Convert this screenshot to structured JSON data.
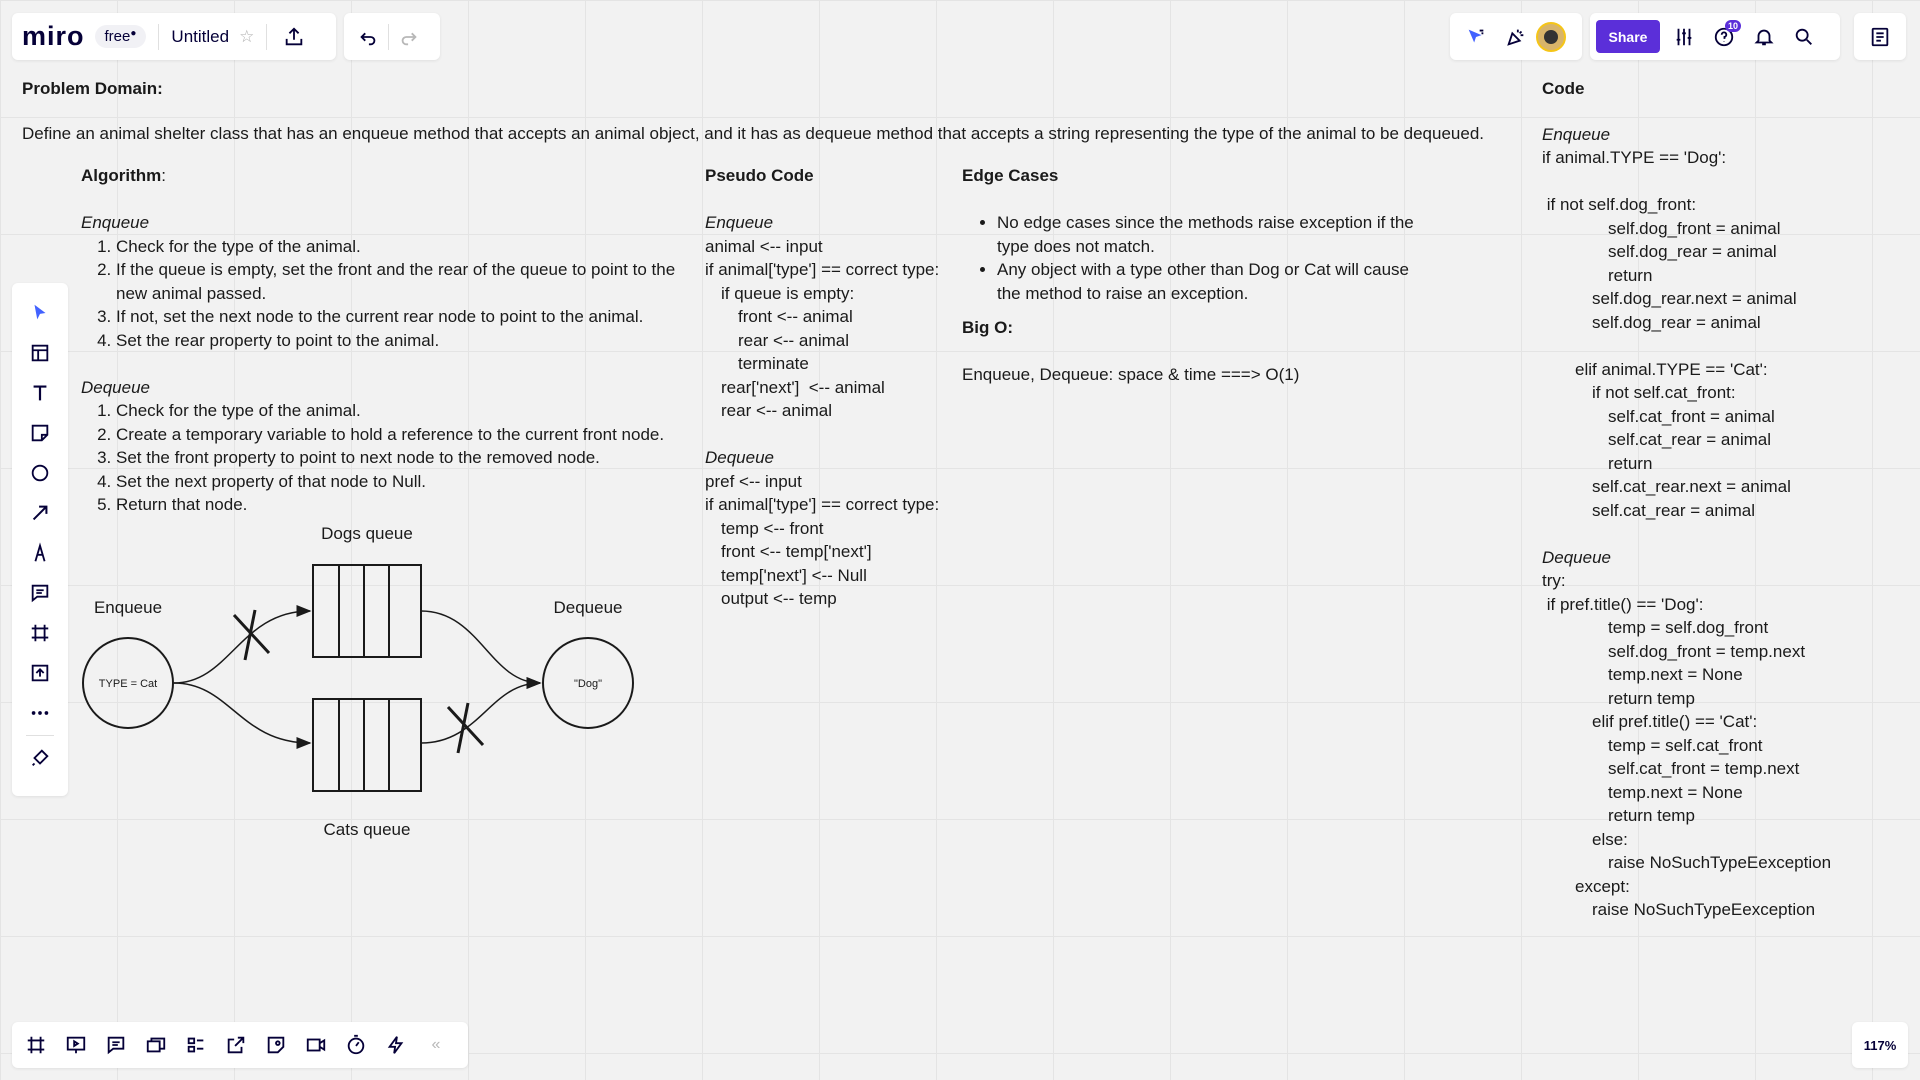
{
  "app": {
    "logo": "miro",
    "plan_badge": "free",
    "board_title": "Untitled",
    "share_label": "Share",
    "notification_count": "10",
    "zoom": "117%"
  },
  "colors": {
    "accent": "#4262ff",
    "share_bg": "#5b2fd9",
    "badge_bg": "#5b2fd9"
  },
  "left_toolbar": [
    "select-icon",
    "templates-icon",
    "text-icon",
    "sticky-note-icon",
    "shape-icon",
    "arrow-icon",
    "pen-icon",
    "comment-icon",
    "frame-icon",
    "upload-icon",
    "more-icon",
    "apps-icon"
  ],
  "bottom_toolbar": [
    "frames-icon",
    "presentation-icon",
    "comments-icon",
    "cards-icon",
    "board-outline-icon",
    "share-link-icon",
    "sticky-capture-icon",
    "video-icon",
    "timer-icon",
    "lightning-icon",
    "collapse-icon"
  ],
  "board": {
    "problem_domain_heading": "Problem Domain:",
    "problem_text": "Define an animal shelter class that has an enqueue method that accepts an animal object, and it has as dequeue method that accepts a string representing the type of the animal to be dequeued.",
    "algorithm": {
      "heading": "Algorithm",
      "colon": ":",
      "enqueue_label": "Enqueue",
      "enqueue_steps": [
        "Check for the type of the animal.",
        "If the queue is empty, set the front and the rear of the queue to point to the new animal passed.",
        "If not, set the next node to the current rear node to point to the animal.",
        "Set the rear property to point to the animal."
      ],
      "dequeue_label": "Dequeue",
      "dequeue_steps": [
        "Check for the type of the animal.",
        "Create a temporary variable to hold a reference to the current front node.",
        "Set the front property to point to next node to the removed node.",
        "Set the next property of that node to Null.",
        "Return that node."
      ]
    },
    "pseudo": {
      "heading": "Pseudo Code",
      "enqueue_label": "Enqueue",
      "enqueue_lines": [
        {
          "t": "animal <-- input",
          "i": 0
        },
        {
          "t": "if animal['type'] == correct type:",
          "i": 0
        },
        {
          "t": "if queue is empty:",
          "i": 1
        },
        {
          "t": "front <-- animal",
          "i": 2
        },
        {
          "t": "rear <-- animal",
          "i": 2
        },
        {
          "t": "terminate",
          "i": 2
        },
        {
          "t": "rear['next']  <-- animal",
          "i": 1
        },
        {
          "t": "rear <-- animal",
          "i": 1
        }
      ],
      "dequeue_label": "Dequeue",
      "dequeue_lines": [
        {
          "t": "pref <-- input",
          "i": 0
        },
        {
          "t": "if animal['type'] == correct type:",
          "i": 0
        },
        {
          "t": "temp <-- front",
          "i": 1
        },
        {
          "t": "front <-- temp['next']",
          "i": 1
        },
        {
          "t": "temp['next'] <-- Null",
          "i": 1
        },
        {
          "t": "output <-- temp",
          "i": 1
        }
      ]
    },
    "edge": {
      "heading": "Edge Cases",
      "items": [
        "No edge cases since the methods raise exception if the type does not match.",
        "Any object with a type other than Dog or Cat will cause the method to raise an exception."
      ],
      "bigo_heading": "Big O:",
      "bigo_text": "Enqueue, Dequeue: space & time ===> O(1)"
    },
    "code": {
      "heading": "Code",
      "enqueue_label": "Enqueue",
      "enqueue_lines": [
        {
          "t": "if animal.TYPE == 'Dog':",
          "i": 0
        },
        {
          "t": "",
          "i": 0
        },
        {
          "t": " if not self.dog_front:",
          "i": 0
        },
        {
          "t": "self.dog_front = animal",
          "i": 4
        },
        {
          "t": "self.dog_rear = animal",
          "i": 4
        },
        {
          "t": "return",
          "i": 4
        },
        {
          "t": "self.dog_rear.next = animal",
          "i": 3
        },
        {
          "t": "self.dog_rear = animal",
          "i": 3
        },
        {
          "t": "",
          "i": 0
        },
        {
          "t": "elif animal.TYPE == 'Cat':",
          "i": 2
        },
        {
          "t": "if not self.cat_front:",
          "i": 3
        },
        {
          "t": "self.cat_front = animal",
          "i": 4
        },
        {
          "t": "self.cat_rear = animal",
          "i": 4
        },
        {
          "t": "return",
          "i": 4
        },
        {
          "t": "self.cat_rear.next = animal",
          "i": 3
        },
        {
          "t": "self.cat_rear = animal",
          "i": 3
        }
      ],
      "dequeue_label": "Dequeue",
      "dequeue_lines": [
        {
          "t": "try:",
          "i": 0
        },
        {
          "t": " if pref.title() == 'Dog':",
          "i": 0
        },
        {
          "t": "temp = self.dog_front",
          "i": 4
        },
        {
          "t": "self.dog_front = temp.next",
          "i": 4
        },
        {
          "t": "temp.next = None",
          "i": 4
        },
        {
          "t": "return temp",
          "i": 4
        },
        {
          "t": "elif pref.title() == 'Cat':",
          "i": 3
        },
        {
          "t": "temp = self.cat_front",
          "i": 4
        },
        {
          "t": "self.cat_front = temp.next",
          "i": 4
        },
        {
          "t": "temp.next = None",
          "i": 4
        },
        {
          "t": "return temp",
          "i": 4
        },
        {
          "t": "else:",
          "i": 3
        },
        {
          "t": "raise NoSuchTypeEexception",
          "i": 4
        },
        {
          "t": "except:",
          "i": 2
        },
        {
          "t": "raise NoSuchTypeEexception",
          "i": 3
        }
      ]
    },
    "diagram": {
      "dogs_queue": "Dogs queue",
      "cats_queue": "Cats queue",
      "enqueue": "Enqueue",
      "dequeue": "Dequeue",
      "enqueue_node": "TYPE = Cat",
      "dequeue_node": "\"Dog\""
    }
  }
}
